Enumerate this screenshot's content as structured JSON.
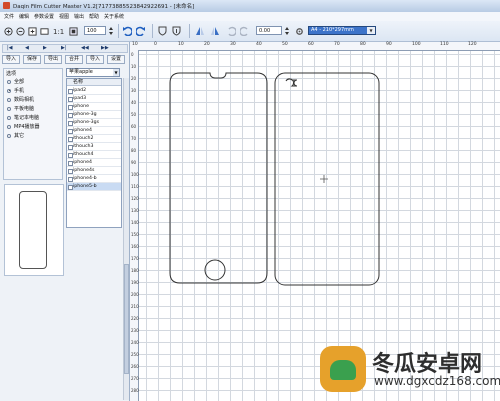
{
  "window": {
    "title": "Daqin Film Cutter Master  V1.2[71773885523842922691 - [未命名]"
  },
  "menu": [
    "文件",
    "编辑",
    "参数设置",
    "视图",
    "输出",
    "帮助",
    "关于系统"
  ],
  "toolbar": {
    "zoom_value": "100",
    "rotate_value": "0.00",
    "paper_size": "A4 - 210*297mm",
    "icons": [
      "new-icon",
      "open-icon",
      "save-icon",
      "zoom-in-icon",
      "zoom-out-icon",
      "actual-size-icon",
      "undo-icon",
      "redo-icon",
      "flip-horizontal-icon",
      "flip-vertical-icon",
      "rotate-left-icon",
      "rotate-right-icon",
      "settings-icon"
    ]
  },
  "left_panel": {
    "nav_buttons": [
      "|◀",
      "◀",
      "▶",
      "▶|",
      "◀◀",
      "▶▶"
    ],
    "action_buttons": [
      "导入",
      "保存",
      "导出",
      "合并",
      "导入",
      "设置"
    ],
    "category_group": {
      "title": "选项",
      "options": [
        "全部",
        "手机",
        "数码相机",
        "平板电脑",
        "笔记本电脑",
        "MP4播放器",
        "其它"
      ],
      "selected_index": 1
    },
    "brand_select": "苹果apple",
    "model_list": {
      "header": "名称",
      "items": [
        "ipad2",
        "ipad3",
        "iphone",
        "iphone-3g",
        "iphone-3gs",
        "iphone4",
        "ithouch2",
        "ithouch3",
        "ithouch4",
        "iphone4",
        "iphone4s",
        "iphone4-b",
        "iphone5-b"
      ],
      "selected_index": 12
    }
  },
  "rulers": {
    "top_labels": [
      "10",
      "0",
      "10",
      "20",
      "30",
      "40",
      "50",
      "60",
      "70",
      "80",
      "90",
      "100",
      "110",
      "120"
    ],
    "left_labels": [
      "0",
      "10",
      "20",
      "30",
      "40",
      "50",
      "60",
      "70",
      "80",
      "90",
      "100",
      "110",
      "120",
      "130",
      "140",
      "150",
      "160",
      "170",
      "180",
      "190",
      "200",
      "210",
      "220",
      "230",
      "240",
      "250",
      "260",
      "270",
      "280"
    ]
  },
  "watermark": {
    "line1": "冬瓜安卓网",
    "line2": "www.dgxcdz168.com"
  }
}
